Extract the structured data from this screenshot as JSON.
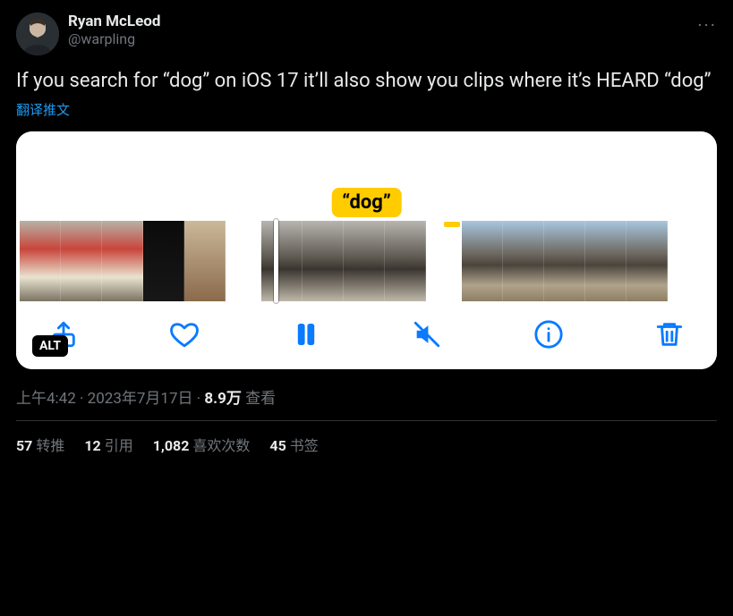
{
  "author": {
    "display_name": "Ryan McLeod",
    "handle": "@warpling"
  },
  "tweet_text": "If you search for “dog” on iOS 17 it’ll also show you clips where it’s HEARD “dog”",
  "translate_label": "翻译推文",
  "media": {
    "bubble_text": "“dog”",
    "alt_label": "ALT"
  },
  "meta": {
    "time": "上午4:42",
    "separator": " · ",
    "date": "2023年7月17日",
    "views_count": "8.9万",
    "views_label": " 查看"
  },
  "stats": {
    "retweets": {
      "count": "57",
      "label": "转推"
    },
    "quotes": {
      "count": "12",
      "label": "引用"
    },
    "likes": {
      "count": "1,082",
      "label": "喜欢次数"
    },
    "bookmarks": {
      "count": "45",
      "label": "书签"
    }
  },
  "more_glyph": "···"
}
